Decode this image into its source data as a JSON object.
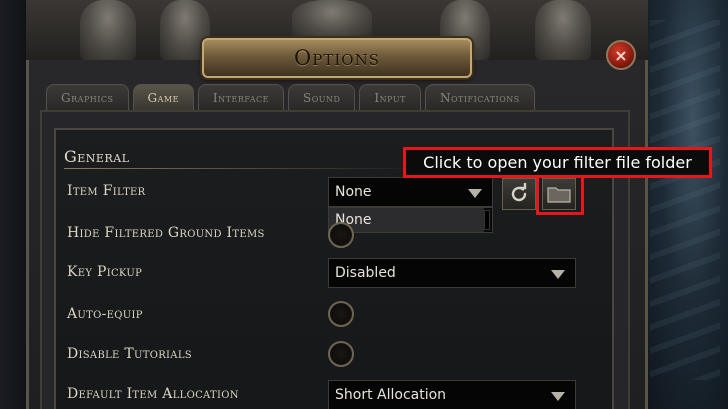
{
  "window": {
    "title": "Options",
    "close_label": "×"
  },
  "tabs": [
    {
      "label": "Graphics",
      "active": false
    },
    {
      "label": "Game",
      "active": true
    },
    {
      "label": "Interface",
      "active": false
    },
    {
      "label": "Sound",
      "active": false
    },
    {
      "label": "Input",
      "active": false
    },
    {
      "label": "Notifications",
      "active": false
    }
  ],
  "section": {
    "title": "General"
  },
  "settings": {
    "item_filter": {
      "label": "Item Filter",
      "value": "None",
      "dropdown_option": "None"
    },
    "hide_filtered": {
      "label": "Hide Filtered Ground Items"
    },
    "key_pickup": {
      "label": "Key Pickup",
      "value": "Disabled"
    },
    "auto_equip": {
      "label": "Auto-equip"
    },
    "disable_tutorials": {
      "label": "Disable Tutorials"
    },
    "default_item_allocation": {
      "label": "Default Item Allocation",
      "value": "Short Allocation"
    }
  },
  "tooltip": {
    "text": "Click to open your filter file folder"
  },
  "icons": {
    "reload": "refresh-icon",
    "folder": "folder-icon",
    "close": "close-icon",
    "dropdown": "chevron-down-icon"
  },
  "colors": {
    "highlight": "#e6171b",
    "title_plaque": "#a48a5e",
    "close_button": "#d23a2a"
  }
}
